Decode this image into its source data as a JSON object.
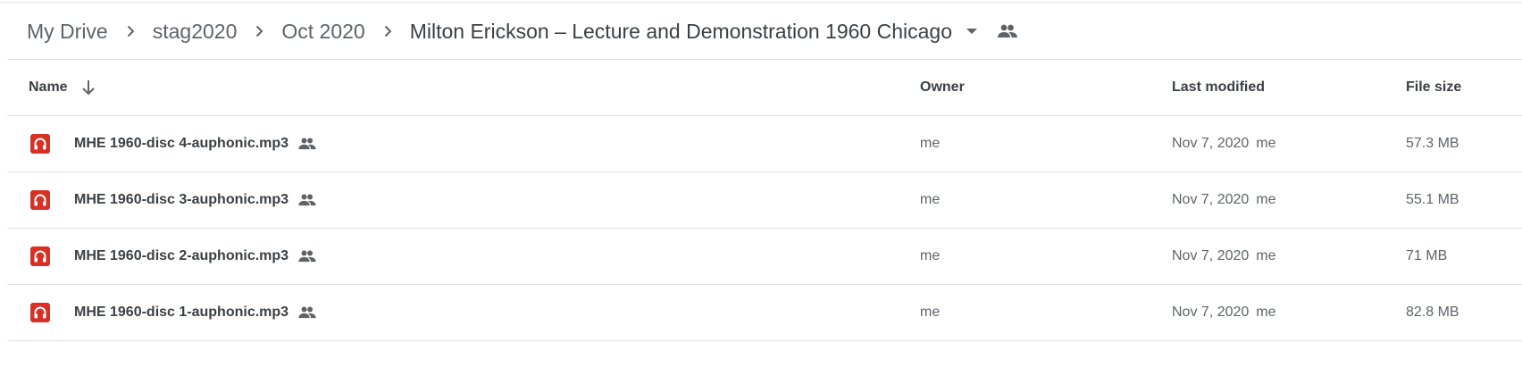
{
  "breadcrumb": {
    "items": [
      {
        "label": "My Drive"
      },
      {
        "label": "stag2020"
      },
      {
        "label": "Oct 2020"
      },
      {
        "label": "Milton Erickson – Lecture and Demonstration 1960 Chicago"
      }
    ],
    "icons": {
      "separator": "chevron-right-icon",
      "menu": "caret-down-icon",
      "shared": "people-icon"
    }
  },
  "table": {
    "headers": {
      "name": "Name",
      "owner": "Owner",
      "modified": "Last modified",
      "size": "File size"
    },
    "sort": {
      "column": "name",
      "direction": "descending",
      "icon": "arrow-down-icon"
    },
    "rows": [
      {
        "name": "MHE 1960-disc 4-auphonic.mp3",
        "owner": "me",
        "modified_date": "Nov 7, 2020",
        "modified_by": "me",
        "size": "57.3 MB"
      },
      {
        "name": "MHE 1960-disc 3-auphonic.mp3",
        "owner": "me",
        "modified_date": "Nov 7, 2020",
        "modified_by": "me",
        "size": "55.1 MB"
      },
      {
        "name": "MHE 1960-disc 2-auphonic.mp3",
        "owner": "me",
        "modified_date": "Nov 7, 2020",
        "modified_by": "me",
        "size": "71 MB"
      },
      {
        "name": "MHE 1960-disc 1-auphonic.mp3",
        "owner": "me",
        "modified_date": "Nov 7, 2020",
        "modified_by": "me",
        "size": "82.8 MB"
      }
    ],
    "file_icon": "audio-file-icon",
    "file_icon_color": "#d93025"
  }
}
